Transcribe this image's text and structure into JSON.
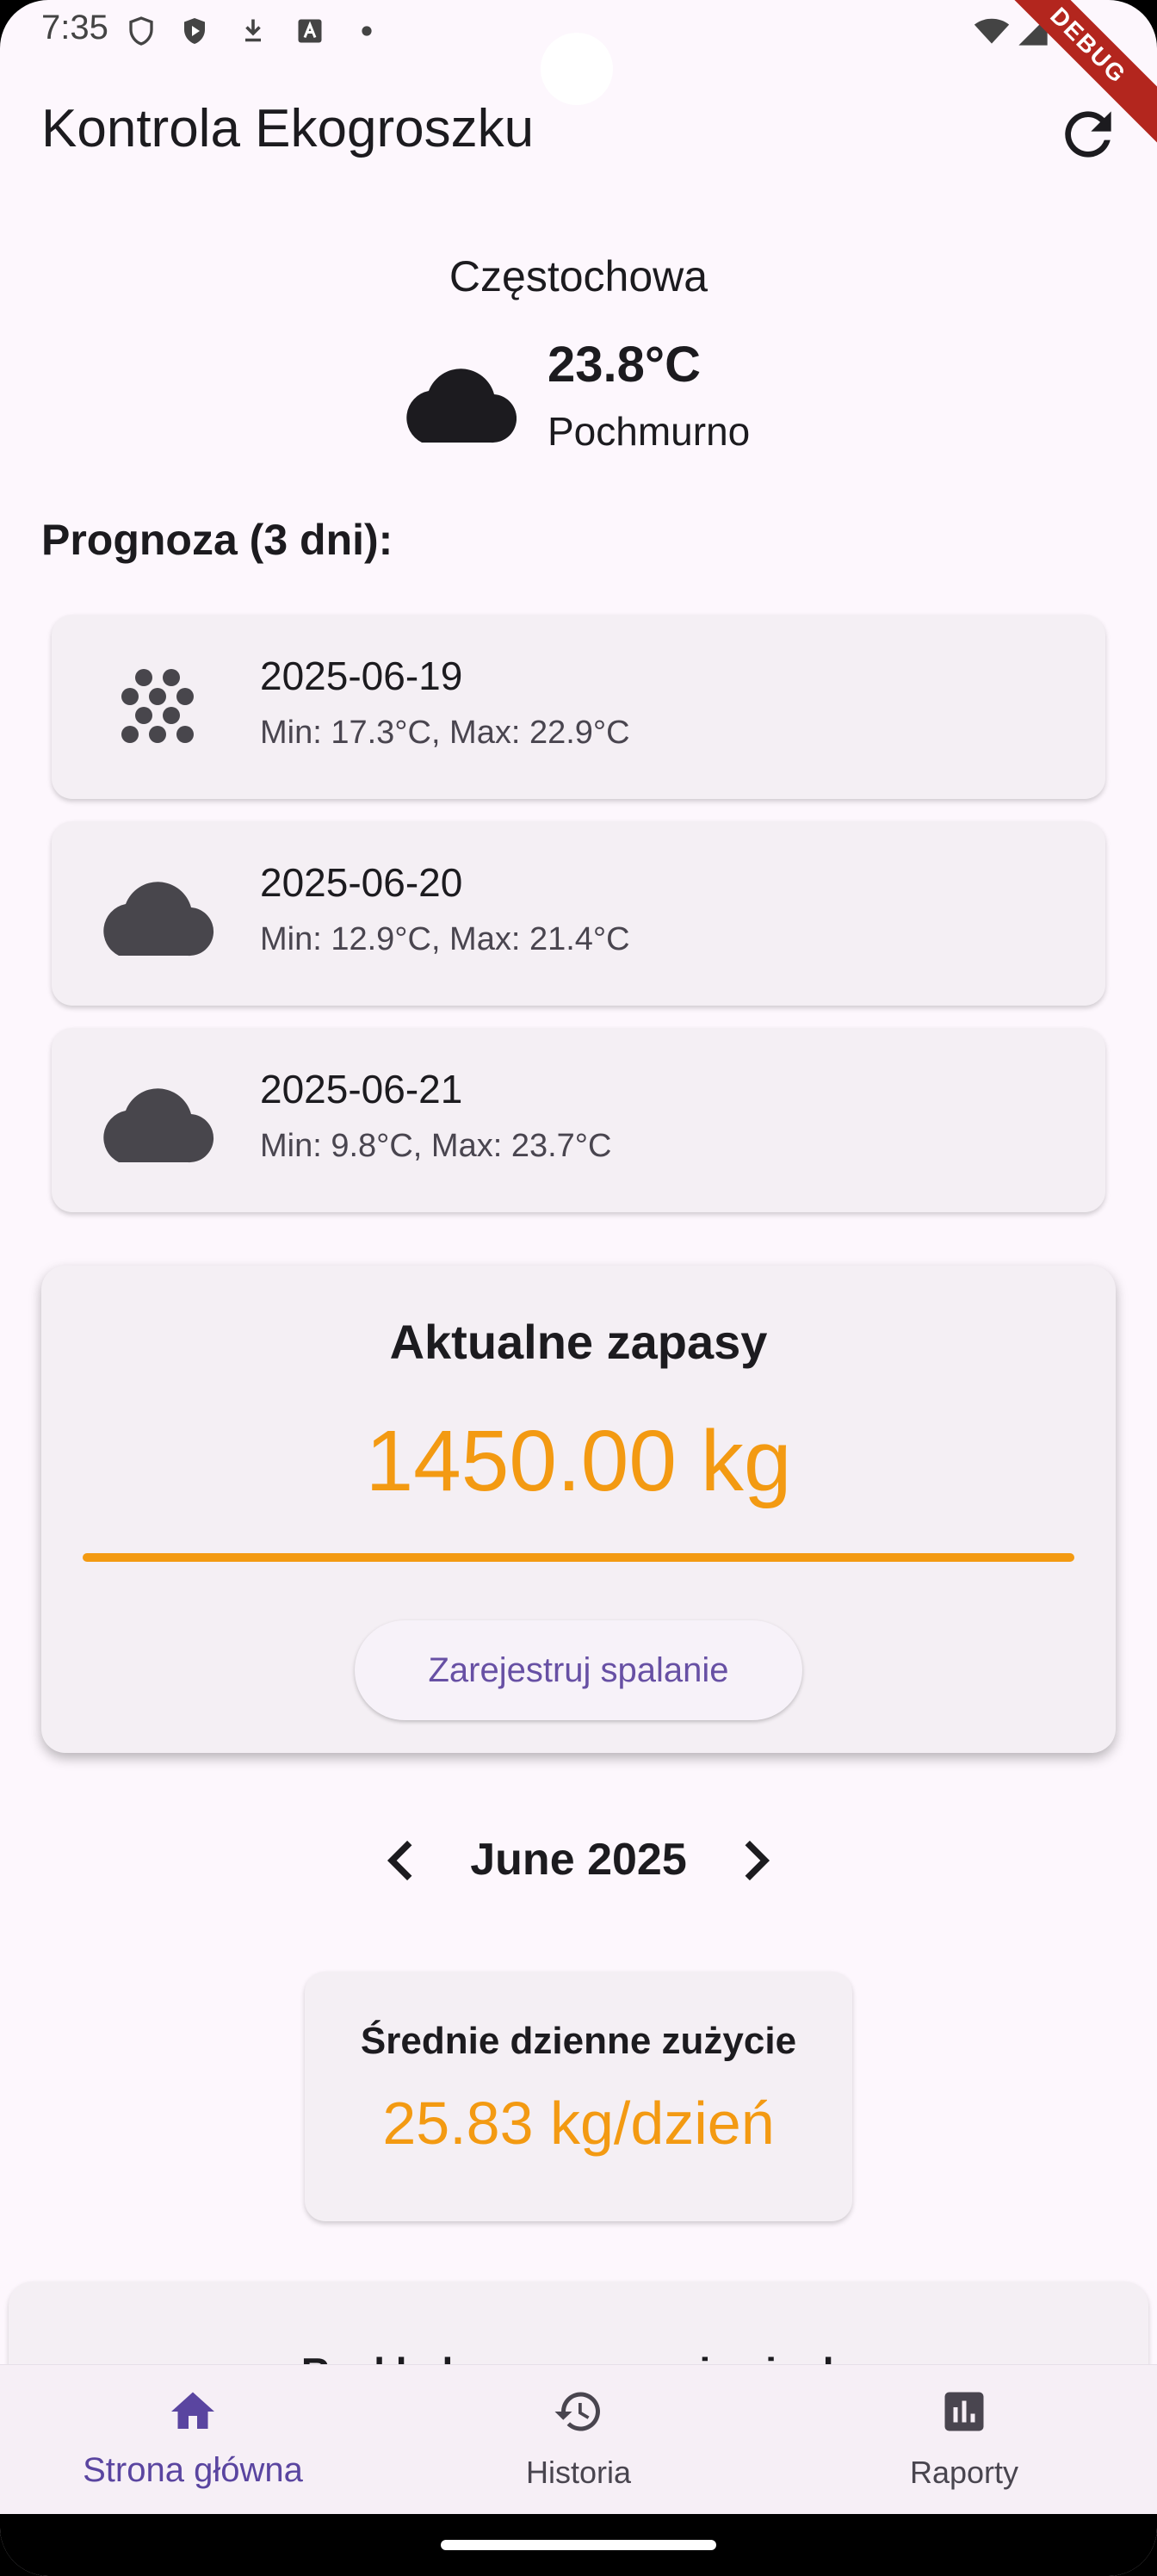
{
  "status_bar": {
    "time": "7:35",
    "debug_label": "DEBUG"
  },
  "app_bar": {
    "title": "Kontrola Ekogroszku",
    "refresh_icon": "refresh-icon"
  },
  "weather": {
    "city": "Częstochowa",
    "temperature": "23.8°C",
    "condition": "Pochmurno",
    "icon": "cloud-icon"
  },
  "forecast": {
    "title": "Prognoza (3 dni):",
    "days": [
      {
        "date": "2025-06-19",
        "range": "Min: 17.3°C, Max: 22.9°C",
        "icon": "snow-dots-icon"
      },
      {
        "date": "2025-06-20",
        "range": "Min: 12.9°C, Max: 21.4°C",
        "icon": "cloud-icon"
      },
      {
        "date": "2025-06-21",
        "range": "Min: 9.8°C, Max: 23.7°C",
        "icon": "cloud-icon"
      }
    ]
  },
  "stock": {
    "title": "Aktualne zapasy",
    "value": "1450.00 kg",
    "progress_percent": 100,
    "burn_button": "Zarejestruj spalanie"
  },
  "month_nav": {
    "label": "June 2025"
  },
  "avg_usage": {
    "title": "Średnie dzienne zużycie",
    "value": "25.83 kg/dzień"
  },
  "heat_card": {
    "title": "Rozkład przeznaczenia ciepła"
  },
  "bottom_nav": {
    "items": [
      {
        "label": "Strona główna",
        "icon": "home-icon",
        "active": true
      },
      {
        "label": "Historia",
        "icon": "history-icon",
        "active": false
      },
      {
        "label": "Raporty",
        "icon": "chart-icon",
        "active": false
      }
    ]
  },
  "colors": {
    "accent": "#f39a12",
    "primary": "#6750a4",
    "background": "#fdf7fd"
  }
}
